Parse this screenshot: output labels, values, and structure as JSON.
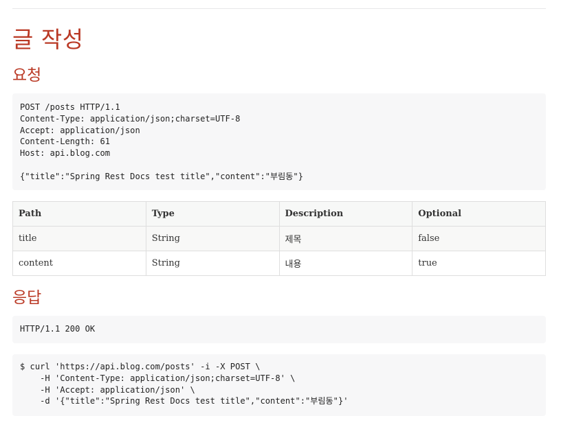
{
  "document": {
    "title": "글 작성",
    "request_heading": "요청",
    "response_heading": "응답"
  },
  "request_snippet": {
    "lines": [
      "POST /posts HTTP/1.1",
      "Content-Type: application/json;charset=UTF-8",
      "Accept: application/json",
      "Content-Length: 61",
      "Host: api.blog.com",
      "",
      "{\"title\":\"Spring Rest Docs test title\",\"content\":\"부림동\"}"
    ]
  },
  "request_fields_table": {
    "headers": [
      "Path",
      "Type",
      "Description",
      "Optional"
    ],
    "rows": [
      [
        "title",
        "String",
        "제목",
        "false"
      ],
      [
        "content",
        "String",
        "내용",
        "true"
      ]
    ]
  },
  "response_snippet": {
    "lines": [
      "HTTP/1.1 200 OK"
    ]
  },
  "curl_snippet": {
    "lines": [
      "$ curl 'https://api.blog.com/posts' -i -X POST \\",
      "    -H 'Content-Type: application/json;charset=UTF-8' \\",
      "    -H 'Accept: application/json' \\",
      "    -d '{\"title\":\"Spring Rest Docs test title\",\"content\":\"부림동\"}'"
    ]
  },
  "colors": {
    "heading": "#ba3925",
    "code_background": "#f7f7f8",
    "table_border": "#dedede"
  }
}
